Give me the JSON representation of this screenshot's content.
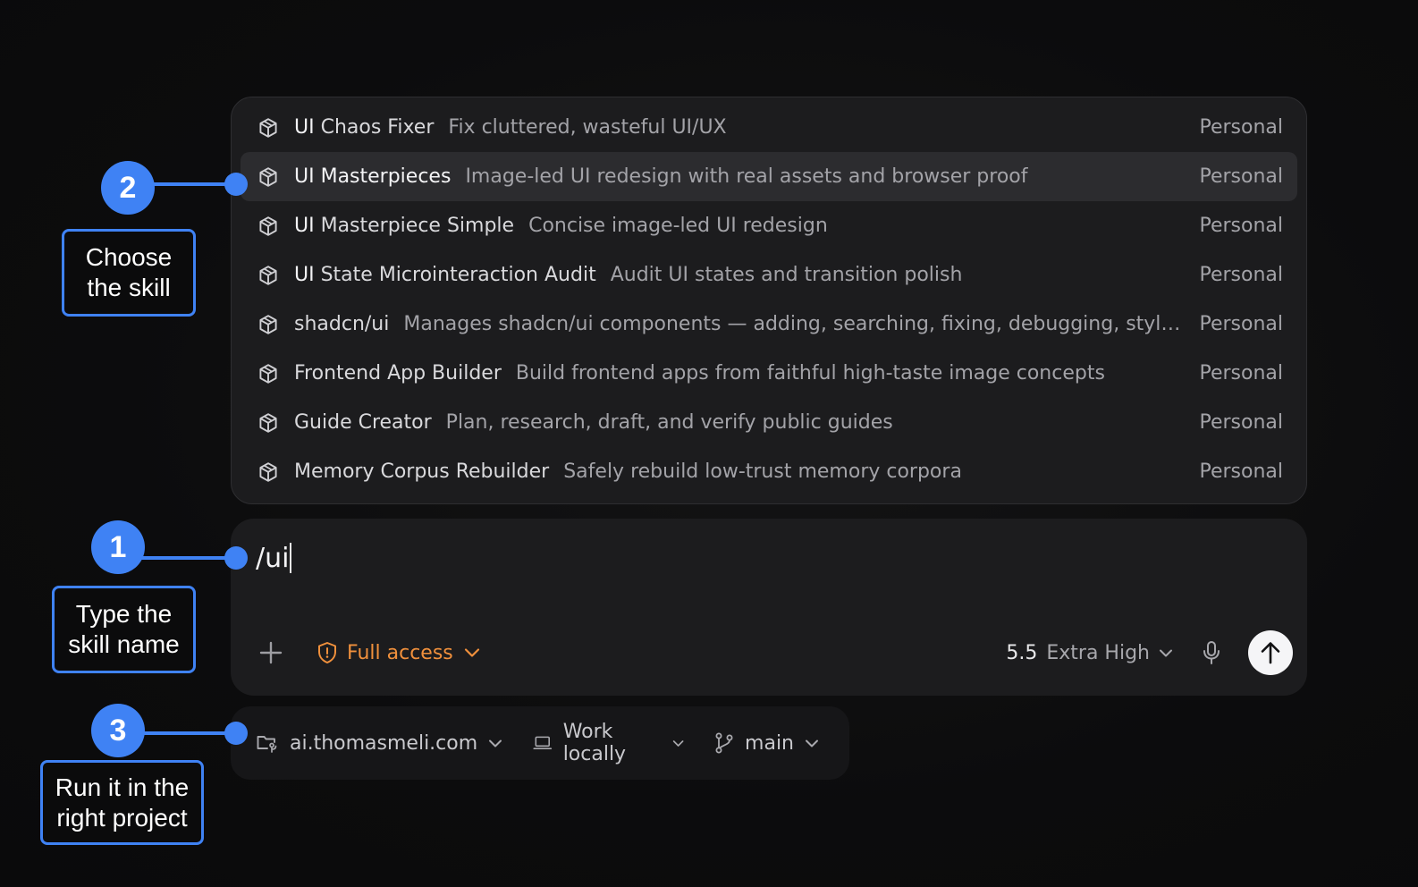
{
  "skills": [
    {
      "prefix": "UI",
      "rest": " Chaos Fixer",
      "desc": "Fix cluttered, wasteful UI/UX",
      "tag": "Personal",
      "selected": false
    },
    {
      "prefix": "UI",
      "rest": " Masterpieces",
      "desc": "Image-led UI redesign with real assets and browser proof",
      "tag": "Personal",
      "selected": true
    },
    {
      "prefix": "UI",
      "rest": " Masterpiece Simple",
      "desc": "Concise image-led UI redesign",
      "tag": "Personal",
      "selected": false
    },
    {
      "prefix": "UI",
      "rest": " State Microinteraction Audit",
      "desc": "Audit UI states and transition polish",
      "tag": "Personal",
      "selected": false
    },
    {
      "prefix": "",
      "rest": "shadcn/ui",
      "desc": "Manages shadcn/ui components — adding, searching, fixing, debugging, styling, and co...",
      "tag": "Personal",
      "selected": false
    },
    {
      "prefix": "",
      "rest": "Frontend App Builder",
      "desc": "Build frontend apps from faithful high-taste image concepts",
      "tag": "Personal",
      "selected": false
    },
    {
      "prefix": "",
      "rest": "Guide Creator",
      "desc": "Plan, research, draft, and verify public guides",
      "tag": "Personal",
      "selected": false
    },
    {
      "prefix": "",
      "rest": "Memory Corpus Rebuilder",
      "desc": "Safely rebuild low-trust memory corpora",
      "tag": "Personal",
      "selected": false
    }
  ],
  "skill_icon": "skill-cube-icon",
  "composer": {
    "input_value": "/ui",
    "access_label": "Full access",
    "model_version": "5.5",
    "model_level": "Extra High"
  },
  "project": {
    "repo": "ai.thomasmeli.com",
    "environment": "Work locally",
    "branch": "main"
  },
  "annotations": {
    "step1": {
      "number": "1",
      "line1": "Type the",
      "line2": "skill name"
    },
    "step2": {
      "number": "2",
      "line1": "Choose",
      "line2": "the skill"
    },
    "step3": {
      "number": "3",
      "line1": "Run it in the",
      "line2": "right project"
    }
  },
  "colors": {
    "accent": "#3f82f4",
    "access": "#f0903c",
    "panel": "#1c1c1e",
    "background": "#0c0c0d"
  }
}
